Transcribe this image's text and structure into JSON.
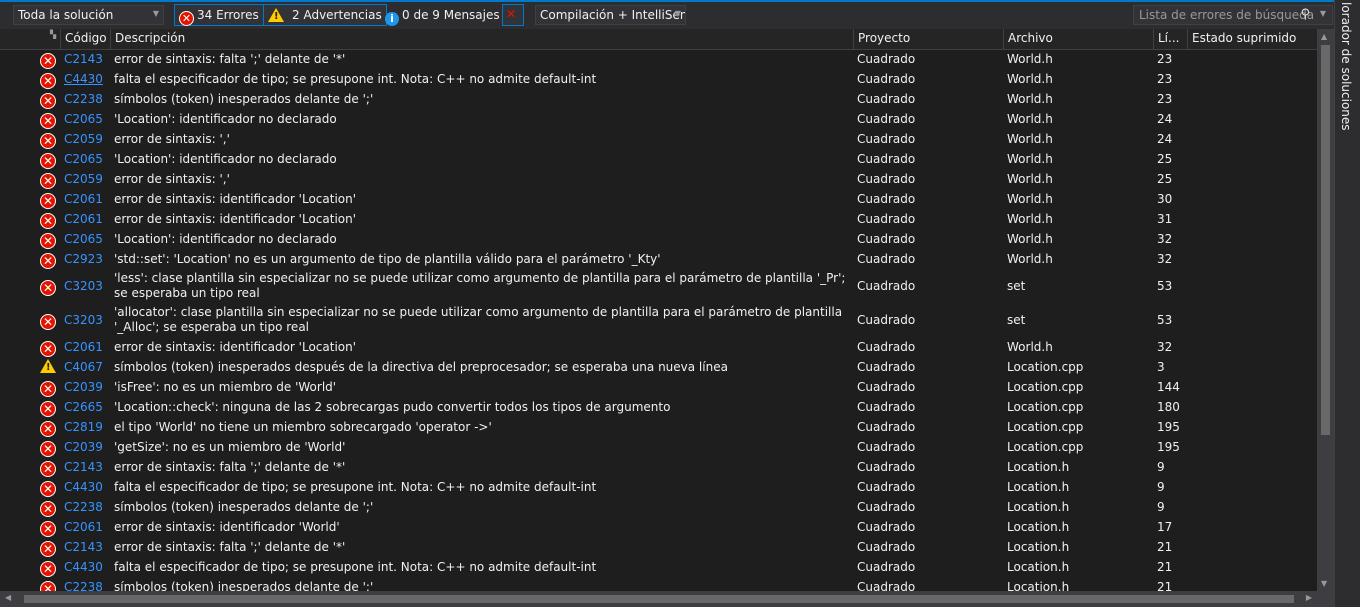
{
  "toolbar": {
    "scope": "Toda la solución",
    "errors": "34 Errores",
    "warnings": "2 Advertencias",
    "messages": "0 de 9 Mensajes",
    "build_filter": "Compilación + IntelliSen",
    "search_placeholder": "Lista de errores de búsqueda"
  },
  "side_tab": "lorador de soluciones",
  "columns": {
    "code": "Código",
    "description": "Descripción",
    "project": "Proyecto",
    "file": "Archivo",
    "line": "Lí...",
    "suppressed": "Estado suprimido"
  },
  "rows": [
    {
      "type": "error",
      "code": "C2143",
      "desc": "error de sintaxis: falta ';' delante de '*'",
      "project": "Cuadrado",
      "file": "World.h",
      "line": "23"
    },
    {
      "type": "error",
      "code": "C4430",
      "desc": "falta el especificador de tipo; se presupone int. Nota: C++ no admite default-int",
      "project": "Cuadrado",
      "file": "World.h",
      "line": "23"
    },
    {
      "type": "error",
      "code": "C2238",
      "desc": "símbolos (token) inesperados delante de ';'",
      "project": "Cuadrado",
      "file": "World.h",
      "line": "23"
    },
    {
      "type": "error",
      "code": "C2065",
      "desc": "'Location': identificador no declarado",
      "project": "Cuadrado",
      "file": "World.h",
      "line": "24"
    },
    {
      "type": "error",
      "code": "C2059",
      "desc": "error de sintaxis: ','",
      "project": "Cuadrado",
      "file": "World.h",
      "line": "24"
    },
    {
      "type": "error",
      "code": "C2065",
      "desc": "'Location': identificador no declarado",
      "project": "Cuadrado",
      "file": "World.h",
      "line": "25"
    },
    {
      "type": "error",
      "code": "C2059",
      "desc": "error de sintaxis: ','",
      "project": "Cuadrado",
      "file": "World.h",
      "line": "25"
    },
    {
      "type": "error",
      "code": "C2061",
      "desc": "error de sintaxis: identificador 'Location'",
      "project": "Cuadrado",
      "file": "World.h",
      "line": "30"
    },
    {
      "type": "error",
      "code": "C2061",
      "desc": "error de sintaxis: identificador 'Location'",
      "project": "Cuadrado",
      "file": "World.h",
      "line": "31"
    },
    {
      "type": "error",
      "code": "C2065",
      "desc": "'Location': identificador no declarado",
      "project": "Cuadrado",
      "file": "World.h",
      "line": "32"
    },
    {
      "type": "error",
      "code": "C2923",
      "desc": "'std::set': 'Location' no es un argumento de tipo de plantilla válido para el parámetro '_Kty'",
      "project": "Cuadrado",
      "file": "World.h",
      "line": "32"
    },
    {
      "type": "error",
      "code": "C3203",
      "desc": "'less': clase plantilla sin especializar no se puede utilizar como argumento de plantilla para el parámetro de plantilla '_Pr'; se esperaba un tipo real",
      "project": "Cuadrado",
      "file": "set",
      "line": "53"
    },
    {
      "type": "error",
      "code": "C3203",
      "desc": "'allocator': clase plantilla sin especializar no se puede utilizar como argumento de plantilla para el parámetro de plantilla '_Alloc'; se esperaba un tipo real",
      "project": "Cuadrado",
      "file": "set",
      "line": "53"
    },
    {
      "type": "error",
      "code": "C2061",
      "desc": "error de sintaxis: identificador 'Location'",
      "project": "Cuadrado",
      "file": "World.h",
      "line": "32"
    },
    {
      "type": "warning",
      "code": "C4067",
      "desc": "símbolos (token) inesperados después de la directiva del preprocesador; se esperaba una nueva línea",
      "project": "Cuadrado",
      "file": "Location.cpp",
      "line": "3"
    },
    {
      "type": "error",
      "code": "C2039",
      "desc": "'isFree': no es un miembro de 'World'",
      "project": "Cuadrado",
      "file": "Location.cpp",
      "line": "144"
    },
    {
      "type": "error",
      "code": "C2665",
      "desc": "'Location::check': ninguna de las 2 sobrecargas pudo convertir todos los tipos de argumento",
      "project": "Cuadrado",
      "file": "Location.cpp",
      "line": "180"
    },
    {
      "type": "error",
      "code": "C2819",
      "desc": "el tipo 'World' no tiene un miembro sobrecargado 'operator ->'",
      "project": "Cuadrado",
      "file": "Location.cpp",
      "line": "195"
    },
    {
      "type": "error",
      "code": "C2039",
      "desc": "'getSize': no es un miembro de 'World'",
      "project": "Cuadrado",
      "file": "Location.cpp",
      "line": "195"
    },
    {
      "type": "error",
      "code": "C2143",
      "desc": "error de sintaxis: falta ';' delante de '*'",
      "project": "Cuadrado",
      "file": "Location.h",
      "line": "9"
    },
    {
      "type": "error",
      "code": "C4430",
      "desc": "falta el especificador de tipo; se presupone int. Nota: C++ no admite default-int",
      "project": "Cuadrado",
      "file": "Location.h",
      "line": "9"
    },
    {
      "type": "error",
      "code": "C2238",
      "desc": "símbolos (token) inesperados delante de ';'",
      "project": "Cuadrado",
      "file": "Location.h",
      "line": "9"
    },
    {
      "type": "error",
      "code": "C2061",
      "desc": "error de sintaxis: identificador 'World'",
      "project": "Cuadrado",
      "file": "Location.h",
      "line": "17"
    },
    {
      "type": "error",
      "code": "C2143",
      "desc": "error de sintaxis: falta ';' delante de '*'",
      "project": "Cuadrado",
      "file": "Location.h",
      "line": "21"
    },
    {
      "type": "error",
      "code": "C4430",
      "desc": "falta el especificador de tipo; se presupone int. Nota: C++ no admite default-int",
      "project": "Cuadrado",
      "file": "Location.h",
      "line": "21"
    },
    {
      "type": "error",
      "code": "C2238",
      "desc": "símbolos (token) inesperados delante de ';'",
      "project": "Cuadrado",
      "file": "Location.h",
      "line": "21"
    }
  ]
}
